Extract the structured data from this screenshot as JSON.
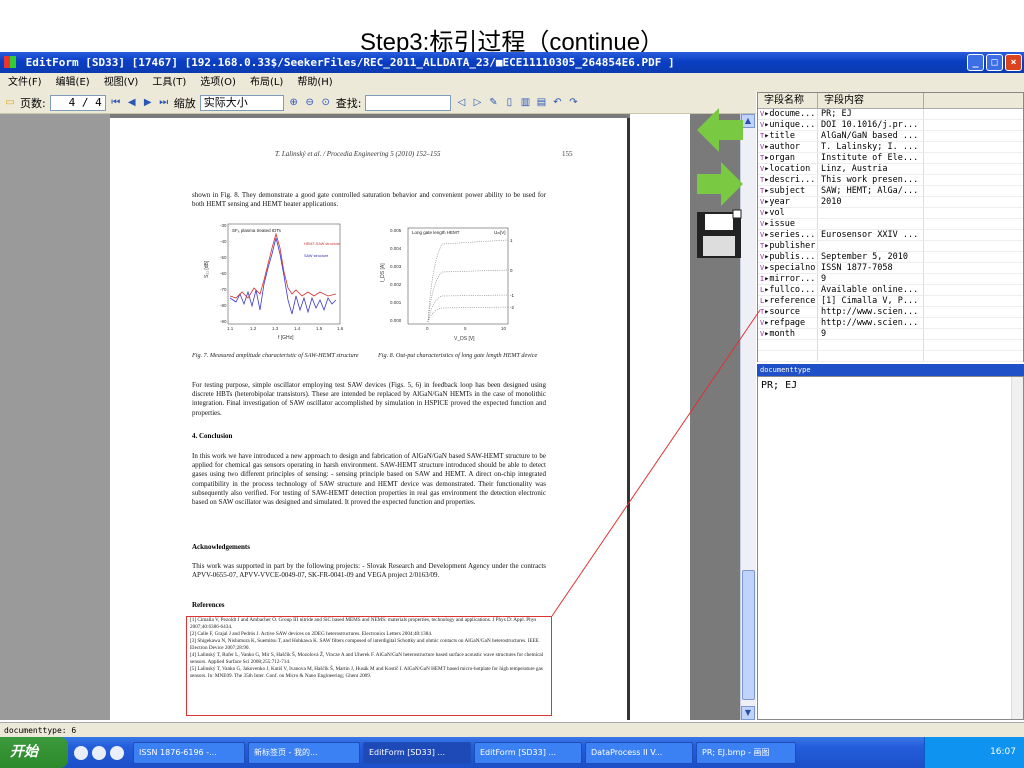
{
  "caption": "Step3:标引过程（continue）",
  "window": {
    "title": "EditForm [SD33] [17467] [192.168.0.33$/SeekerFiles/REC_2011_ALLDATA_23/■ECE11110305_264854E6.PDF ]",
    "min": "_",
    "max": "□",
    "close": "×"
  },
  "menu": [
    "文件(F)",
    "编辑(E)",
    "视图(V)",
    "工具(T)",
    "选项(O)",
    "布局(L)",
    "帮助(H)"
  ],
  "toolbar": {
    "pages_label": "页数:",
    "page_value": "4 / 4",
    "zoom_label": "缩放",
    "zoom_value": "实际大小",
    "search_label": "查找:",
    "search_value": ""
  },
  "document": {
    "running_head": "T. Lalinský et al. / Procedia Engineering 5 (2010) 152–155",
    "page_number": "155",
    "para1": "shown in Fig. 8. They demonstrate a good gate controlled saturation behavior and convenient power ability to be used for both HEMT sensing and HEMT heater applications.",
    "fig7_caption": "Fig. 7. Measured amplitude characteristic of SAW-HEMT structure",
    "fig8_caption": "Fig. 8. Out-put characteristics of long gate length HEMT device",
    "para2": "For testing purpose, simple oscillator employing test SAW devices (Figs. 5, 6) in feedback loop has been designed using discrete HBTs (heterobipolar transistors). These are intended be replaced by AlGaN/GaN HEMTs in the case of monolithic integration. Final investigation of SAW oscillator accomplished by simulation in HSPICE proved the expected function and properties.",
    "conclusion_head": "4. Conclusion",
    "para3": "In this work we have introduced a new approach to design and fabrication of AlGaN/GaN based SAW-HEMT structure to be applied for chemical gas sensors operating in harsh environment. SAW-HEMT structure introduced should be able to detect gases using two different principles of sensing: - sensing principle based on SAW and HEMT. A direct on-chip integrated compatibility in the process technology of SAW structure and HEMT device was demonstrated. Their functionality was subsequently also verified. For testing of SAW-HEMT detection properties in real gas environment the detection electronic based on SAW oscillator was designed and simulated. It proved the expected function and properties.",
    "ack_head": "Acknowledgements",
    "para4": "This work was supported in part by the following projects: - Slovak Research and Development Agency under the contracts APVV-0655-07, APVV-VVCE-0049-07, SK-FR-0041-09 and VEGA project 2/0163/09.",
    "refs_head": "References",
    "refs": [
      "[1] Cimalla V, Pezoldt J and Ambacher O. Group III nitride and SiC based MEMS and NEMS: materials properties, technology and applications. J Phys D: Appl. Phys 2007;40:6386-6434.",
      "[2] Calle F, Grajal J and Pedrós J. Active SAW devices on 2DEG heterostructures. Electronics Letters 2004;40:1384.",
      "[3] Shigekawa N, Nishimura K, Suemitsu T, and Hohkawa K. SAW filters composed of interdigital Schottky and ohmic contacts on AlGaN/GaN heterostructures. IEEE Electron Device 2007;28:90.",
      "[4] Lalinský T, Rufer L, Vanko G, Mir S, Haščík Š, Mozolová Ž, Vincze A and Uherek F. AlGaN/GaN heterostructure based surface acoustic wave structures for chemical sensors. Applied Surface Sci 2008;255:712-714.",
      "[5] Lalinský T, Vanko G, Jakovenko J, Kutiš V, Ivanova M, Haščík Š, Martin J, Husák M and Kostič I. AlGaN/GaN HEMT based micro-hotplate for high temperature gas sensors. In: MNE09. The 35th Inter. Conf. on Micro & Nano Engineering; Ghent 2009."
    ]
  },
  "fig7": {
    "inset": "SF₆ plasma treated IDTs",
    "legend": [
      "HEMT-SAW structure",
      "SAW structure"
    ],
    "xlabel": "f [GHz]",
    "ylabel": "S₂₁ [dB]",
    "xticks": [
      "1.1",
      "1.2",
      "1.3",
      "1.4",
      "1.5",
      "1.6"
    ],
    "yticks": [
      "-30",
      "-40",
      "-50",
      "-60",
      "-70",
      "-80",
      "-90"
    ]
  },
  "fig8": {
    "inset": "Long gate length HEMT",
    "vg_label": "Uₘ[V]",
    "xlabel": "V_DS [V]",
    "ylabel": "I_DS [A]",
    "xticks": [
      "0",
      "5",
      "10"
    ],
    "yticks": [
      "0.005",
      "0.004",
      "0.003",
      "0.002",
      "0.001",
      "0.000"
    ],
    "curve_labels": [
      "1",
      "0",
      "-1",
      "-2"
    ]
  },
  "fields": {
    "header_name": "字段名称",
    "header_value": "字段内容",
    "rows": [
      {
        "type": "V",
        "name": "docume...",
        "value": "PR; EJ"
      },
      {
        "type": "V",
        "name": "unique...",
        "value": "DOI 10.1016/j.pr..."
      },
      {
        "type": "T",
        "name": "title",
        "value": "AlGaN/GaN based ..."
      },
      {
        "type": "V",
        "name": "author",
        "value": "T. Lalinsky; I. ..."
      },
      {
        "type": "T",
        "name": "organ",
        "value": "Institute of Ele..."
      },
      {
        "type": "V",
        "name": "location",
        "value": "Linz, Austria"
      },
      {
        "type": "T",
        "name": "descri...",
        "value": "This work presen..."
      },
      {
        "type": "T",
        "name": "subject",
        "value": "SAW; HEMT; AlGa/..."
      },
      {
        "type": "V",
        "name": "year",
        "value": "2010"
      },
      {
        "type": "V",
        "name": "vol",
        "value": ""
      },
      {
        "type": "V",
        "name": "issue",
        "value": ""
      },
      {
        "type": "V",
        "name": "series...",
        "value": "Eurosensor XXIV ..."
      },
      {
        "type": "T",
        "name": "publisher",
        "value": ""
      },
      {
        "type": "V",
        "name": "publis...",
        "value": "September 5, 2010"
      },
      {
        "type": "V",
        "name": "specialno",
        "value": "ISSN 1877-7058"
      },
      {
        "type": "I",
        "name": "mirror...",
        "value": "9"
      },
      {
        "type": "L",
        "name": "fullco...",
        "value": "Available online..."
      },
      {
        "type": "L",
        "name": "reference",
        "value": "[1] Cimalla V, P..."
      },
      {
        "type": "T",
        "name": "source",
        "value": "http://www.scien..."
      },
      {
        "type": "V",
        "name": "refpage",
        "value": "http://www.scien..."
      },
      {
        "type": "V",
        "name": "month",
        "value": "9"
      }
    ]
  },
  "doctype_panel": {
    "label": "documenttype",
    "value": "PR; EJ"
  },
  "status": "documenttype: 6",
  "taskbar": {
    "start": "开始",
    "buttons": [
      "ISSN 1876-6196 -...",
      "新标签页 - 我的...",
      "EditForm [SD33] ...",
      "EditForm [SD33] ...",
      "DataProcess II V...",
      "PR; EJ.bmp - 画图"
    ],
    "clock": "16:07"
  },
  "colors": {
    "accent": "#0a3fc4",
    "arrow_green": "#7ac943",
    "highlight_red": "#dd3333"
  },
  "icons": [
    "back-arrow-icon",
    "forward-arrow-icon",
    "save-disk-icon"
  ]
}
